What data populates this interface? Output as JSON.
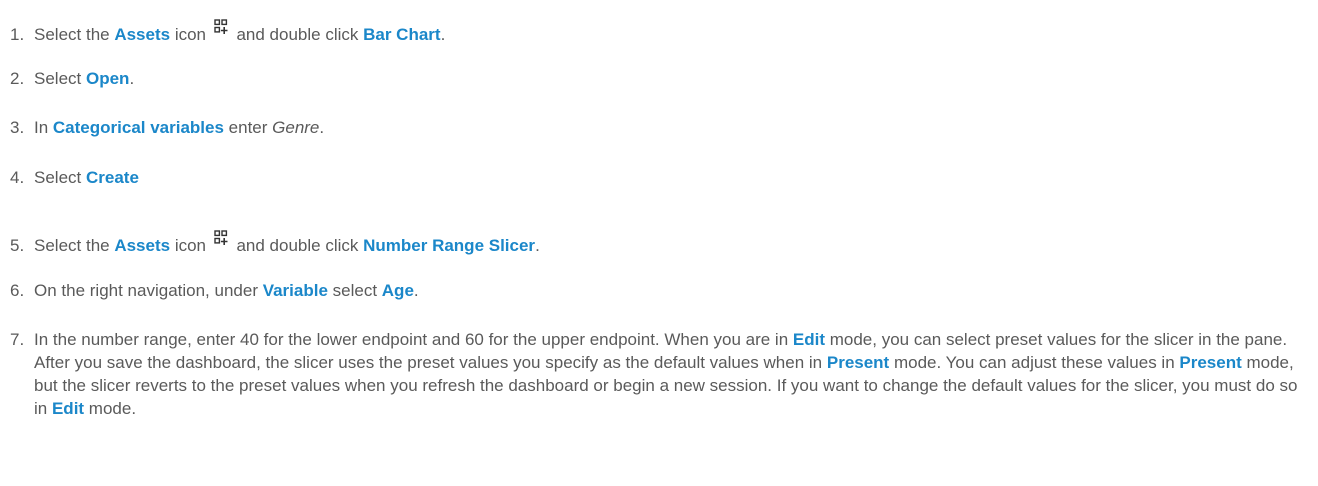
{
  "steps": [
    {
      "num": "1.",
      "parts": [
        {
          "t": "Select the "
        },
        {
          "t": "Assets",
          "s": "b"
        },
        {
          "t": " icon "
        },
        {
          "icon": "assets-icon"
        },
        {
          "t": " and double click "
        },
        {
          "t": "Bar Chart",
          "s": "b"
        },
        {
          "t": "."
        }
      ]
    },
    {
      "num": "2.",
      "parts": [
        {
          "t": "Select "
        },
        {
          "t": "Open",
          "s": "b"
        },
        {
          "t": "."
        }
      ]
    },
    {
      "num": "3.",
      "parts": [
        {
          "t": "In "
        },
        {
          "t": "Categorical variables",
          "s": "b"
        },
        {
          "t": " enter "
        },
        {
          "t": "Genre",
          "s": "i"
        },
        {
          "t": "."
        }
      ]
    },
    {
      "num": "4.",
      "parts": [
        {
          "t": "Select "
        },
        {
          "t": "Create",
          "s": "b"
        }
      ]
    },
    {
      "num": "5.",
      "parts": [
        {
          "t": "Select the "
        },
        {
          "t": "Assets",
          "s": "b"
        },
        {
          "t": " icon "
        },
        {
          "icon": "assets-icon"
        },
        {
          "t": " and double click "
        },
        {
          "t": "Number Range Slicer",
          "s": "b"
        },
        {
          "t": "."
        }
      ]
    },
    {
      "num": "6.",
      "parts": [
        {
          "t": "On the right navigation, under "
        },
        {
          "t": "Variable",
          "s": "b"
        },
        {
          "t": " select "
        },
        {
          "t": "Age",
          "s": "b"
        },
        {
          "t": "."
        }
      ]
    },
    {
      "num": "7.",
      "parts": [
        {
          "t": "In the number range, enter 40 for the lower endpoint and 60 for the upper endpoint. When you are in "
        },
        {
          "t": "Edit",
          "s": "b"
        },
        {
          "t": " mode, you can select preset values for the slicer in the pane. After you save the dashboard, the slicer uses the preset values you specify as the default values when in "
        },
        {
          "t": "Present",
          "s": "b"
        },
        {
          "t": " mode. You can adjust these values in "
        },
        {
          "t": "Present",
          "s": "b"
        },
        {
          "t": " mode, but the slicer reverts to the preset values when you refresh the dashboard or begin a new session. If you want to change the default values for the slicer, you must do so in "
        },
        {
          "t": "Edit",
          "s": "b"
        },
        {
          "t": " mode."
        }
      ]
    }
  ],
  "colors": {
    "text": "#5a5a5a",
    "emphasis": "#1b87c9",
    "icon": "#333333"
  }
}
